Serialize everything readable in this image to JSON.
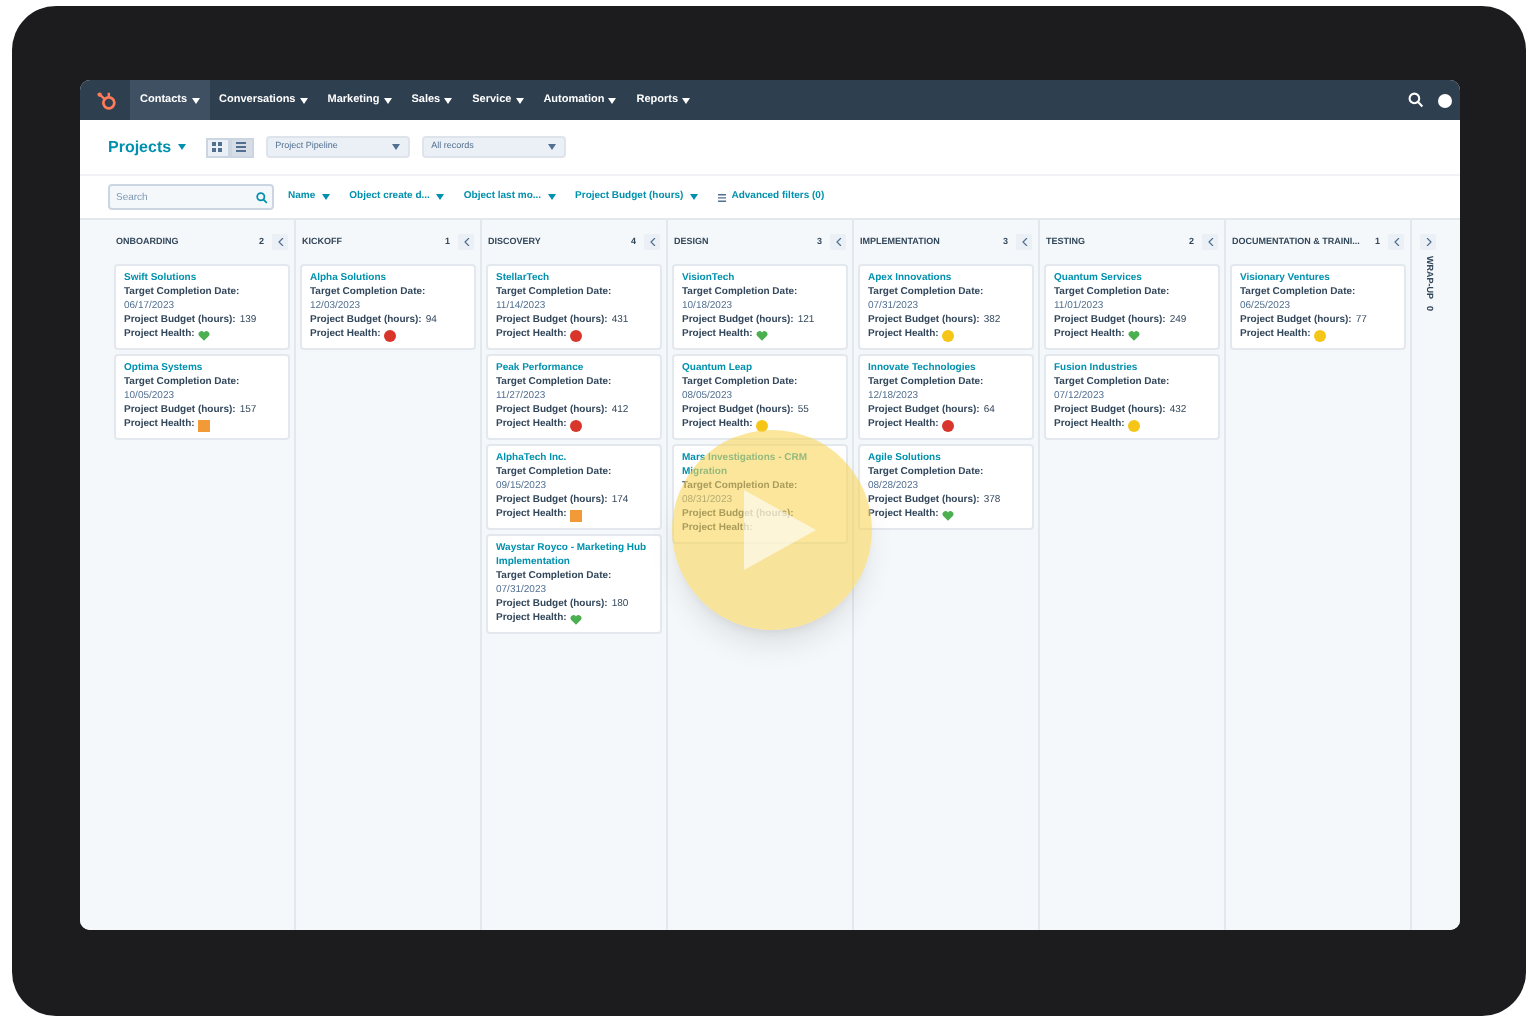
{
  "nav": {
    "items": [
      {
        "label": "Contacts",
        "selected": true
      },
      {
        "label": "Conversations",
        "selected": false
      },
      {
        "label": "Marketing",
        "selected": false
      },
      {
        "label": "Sales",
        "selected": false
      },
      {
        "label": "Service",
        "selected": false
      },
      {
        "label": "Automation",
        "selected": false
      },
      {
        "label": "Reports",
        "selected": false
      }
    ]
  },
  "header": {
    "title": "Projects",
    "views": [
      {
        "kind": "grid",
        "selected": false
      },
      {
        "kind": "list",
        "selected": true
      }
    ],
    "selects": [
      "Project Pipeline",
      "All records"
    ]
  },
  "filters": {
    "search": {
      "placeholder": "Search"
    },
    "buttons": [
      "Name",
      "Object create d...",
      "Object last mo...",
      "Project Budget (hours)"
    ],
    "advanced": "Advanced filters (0)"
  },
  "columns": [
    {
      "name": "ONBOARDING",
      "count": "2",
      "cards": [
        {
          "title": "Swift Solutions",
          "date_label": "Target Completion Date:",
          "date": "06/17/2023",
          "budget_label": "Project Budget (hours):",
          "budget": "139",
          "health_label": "Project Health:",
          "health": {
            "kind": "heart",
            "color": "#4caf50"
          }
        },
        {
          "title": "Optima Systems",
          "date_label": "Target Completion Date:",
          "date": "10/05/2023",
          "budget_label": "Project Budget (hours):",
          "budget": "157",
          "health_label": "Project Health:",
          "health": {
            "kind": "square",
            "color": "#f29a38"
          }
        }
      ]
    },
    {
      "name": "KICKOFF",
      "count": "1",
      "cards": [
        {
          "title": "Alpha Solutions",
          "date_label": "Target Completion Date:",
          "date": "12/03/2023",
          "budget_label": "Project Budget (hours):",
          "budget": "94",
          "health_label": "Project Health:",
          "health": {
            "kind": "circle",
            "color": "#d9362b"
          }
        }
      ]
    },
    {
      "name": "DISCOVERY",
      "count": "4",
      "cards": [
        {
          "title": "StellarTech",
          "date_label": "Target Completion Date:",
          "date": "11/14/2023",
          "budget_label": "Project Budget (hours):",
          "budget": "431",
          "health_label": "Project Health:",
          "health": {
            "kind": "circle",
            "color": "#d9362b"
          }
        },
        {
          "title": "Peak Performance",
          "date_label": "Target Completion Date:",
          "date": "11/27/2023",
          "budget_label": "Project Budget (hours):",
          "budget": "412",
          "health_label": "Project Health:",
          "health": {
            "kind": "circle",
            "color": "#d9362b"
          }
        },
        {
          "title": "AlphaTech Inc.",
          "date_label": "Target Completion Date:",
          "date": "09/15/2023",
          "budget_label": "Project Budget (hours):",
          "budget": "174",
          "health_label": "Project Health:",
          "health": {
            "kind": "square",
            "color": "#f29a38"
          }
        },
        {
          "title": "Waystar Royco - Marketing Hub Implementation",
          "date_label": "Target Completion Date:",
          "date": "07/31/2023",
          "budget_label": "Project Budget (hours):",
          "budget": "180",
          "health_label": "Project Health:",
          "health": {
            "kind": "heart",
            "color": "#4caf50"
          }
        }
      ]
    },
    {
      "name": "DESIGN",
      "count": "3",
      "cards": [
        {
          "title": "VisionTech",
          "date_label": "Target Completion Date:",
          "date": "10/18/2023",
          "budget_label": "Project Budget (hours):",
          "budget": "121",
          "health_label": "Project Health:",
          "health": {
            "kind": "heart",
            "color": "#4caf50"
          }
        },
        {
          "title": "Quantum Leap",
          "date_label": "Target Completion Date:",
          "date": "08/05/2023",
          "budget_label": "Project Budget (hours):",
          "budget": "55",
          "health_label": "Project Health:",
          "health": {
            "kind": "circle",
            "color": "#f5c518"
          }
        },
        {
          "title": "Mars Investigations - CRM Migration",
          "date_label": "Target Completion Date:",
          "date": "08/31/2023",
          "budget_label": "Project Budget (hours):",
          "health_label": "Project Health:"
        }
      ]
    },
    {
      "name": "IMPLEMENTATION",
      "count": "3",
      "cards": [
        {
          "title": "Apex Innovations",
          "date_label": "Target Completion Date:",
          "date": "07/31/2023",
          "budget_label": "Project Budget (hours):",
          "budget": "382",
          "health_label": "Project Health:",
          "health": {
            "kind": "circle",
            "color": "#f5c518"
          }
        },
        {
          "title": "Innovate Technologies",
          "date_label": "Target Completion Date:",
          "date": "12/18/2023",
          "budget_label": "Project Budget (hours):",
          "budget": "64",
          "health_label": "Project Health:",
          "health": {
            "kind": "circle",
            "color": "#d9362b"
          }
        },
        {
          "title": "Agile Solutions",
          "date_label": "Target Completion Date:",
          "date": "08/28/2023",
          "budget_label": "Project Budget (hours):",
          "budget": "378",
          "health_label": "Project Health:",
          "health": {
            "kind": "heart",
            "color": "#4caf50"
          }
        }
      ]
    },
    {
      "name": "TESTING",
      "count": "2",
      "cards": [
        {
          "title": "Quantum Services",
          "date_label": "Target Completion Date:",
          "date": "11/01/2023",
          "budget_label": "Project Budget (hours):",
          "budget": "249",
          "health_label": "Project Health:",
          "health": {
            "kind": "heart",
            "color": "#4caf50"
          }
        },
        {
          "title": "Fusion Industries",
          "date_label": "Target Completion Date:",
          "date": "07/12/2023",
          "budget_label": "Project Budget (hours):",
          "budget": "432",
          "health_label": "Project Health:",
          "health": {
            "kind": "circle",
            "color": "#f5c518"
          }
        }
      ]
    },
    {
      "name": "DOCUMENTATION & TRAINI...",
      "count": "1",
      "cards": [
        {
          "title": "Visionary Ventures",
          "date_label": "Target Completion Date:",
          "date": "06/25/2023",
          "budget_label": "Project Budget (hours):",
          "budget": "77",
          "health_label": "Project Health:",
          "health": {
            "kind": "circle",
            "color": "#f5c518"
          }
        }
      ]
    }
  ],
  "collapsed_column": {
    "name": "WRAP-UP",
    "count": "0"
  }
}
